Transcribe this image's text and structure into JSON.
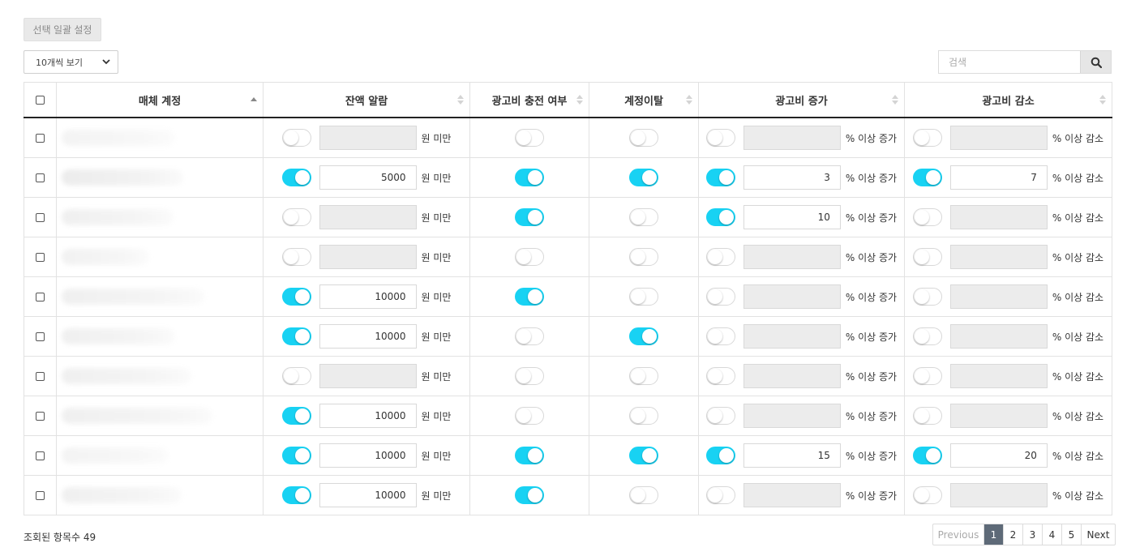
{
  "toolbar": {
    "bulk_settings_label": "선택 일괄 설정",
    "page_size_label": "10개씩 보기",
    "search_placeholder": "검색"
  },
  "columns": {
    "account": "매체 계정",
    "balance_alarm": "잔액 알람",
    "ad_charge": "광고비 충전 여부",
    "account_leave": "계정이탈",
    "ad_increase": "광고비 증가",
    "ad_decrease": "광고비 감소"
  },
  "units": {
    "balance": "원 미만",
    "increase": "% 이상 증가",
    "decrease": "% 이상 감소"
  },
  "rows": [
    {
      "balance_on": false,
      "balance": "",
      "charge_on": false,
      "leave_on": false,
      "inc_on": false,
      "inc": "",
      "dec_on": false,
      "dec": ""
    },
    {
      "balance_on": true,
      "balance": "5000",
      "charge_on": true,
      "leave_on": true,
      "inc_on": true,
      "inc": "3",
      "dec_on": true,
      "dec": "7"
    },
    {
      "balance_on": false,
      "balance": "",
      "charge_on": true,
      "leave_on": false,
      "inc_on": true,
      "inc": "10",
      "dec_on": false,
      "dec": ""
    },
    {
      "balance_on": false,
      "balance": "",
      "charge_on": false,
      "leave_on": false,
      "inc_on": false,
      "inc": "",
      "dec_on": false,
      "dec": ""
    },
    {
      "balance_on": true,
      "balance": "10000",
      "charge_on": true,
      "leave_on": false,
      "inc_on": false,
      "inc": "",
      "dec_on": false,
      "dec": ""
    },
    {
      "balance_on": true,
      "balance": "10000",
      "charge_on": false,
      "leave_on": true,
      "inc_on": false,
      "inc": "",
      "dec_on": false,
      "dec": ""
    },
    {
      "balance_on": false,
      "balance": "",
      "charge_on": false,
      "leave_on": false,
      "inc_on": false,
      "inc": "",
      "dec_on": false,
      "dec": ""
    },
    {
      "balance_on": true,
      "balance": "10000",
      "charge_on": false,
      "leave_on": false,
      "inc_on": false,
      "inc": "",
      "dec_on": false,
      "dec": ""
    },
    {
      "balance_on": true,
      "balance": "10000",
      "charge_on": true,
      "leave_on": true,
      "inc_on": true,
      "inc": "15",
      "dec_on": true,
      "dec": "20"
    },
    {
      "balance_on": true,
      "balance": "10000",
      "charge_on": true,
      "leave_on": false,
      "inc_on": false,
      "inc": "",
      "dec_on": false,
      "dec": ""
    }
  ],
  "footer": {
    "count_label": "조회된 항목수 49",
    "pagination": {
      "prev": "Previous",
      "pages": [
        "1",
        "2",
        "3",
        "4",
        "5"
      ],
      "current": "1",
      "next": "Next"
    }
  },
  "colors": {
    "toggle_on": "#18d2f3",
    "active_page": "#5e6a78"
  }
}
